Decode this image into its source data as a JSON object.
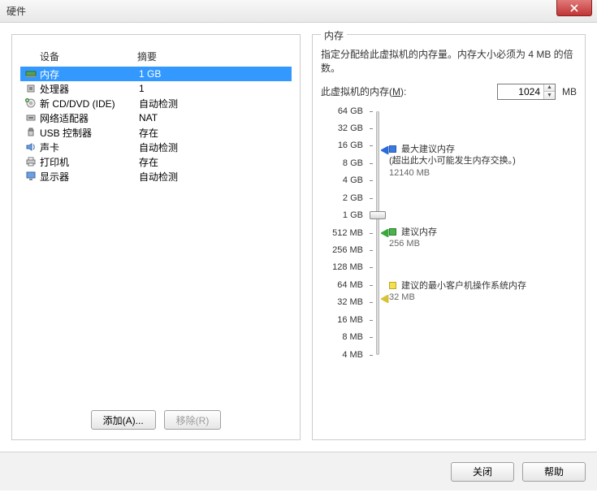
{
  "window_title": "硬件",
  "left": {
    "title": "",
    "headers": {
      "device": "设备",
      "summary": "摘要"
    },
    "devices": [
      {
        "name": "内存",
        "summary": "1 GB",
        "icon": "memory-icon",
        "selected": true
      },
      {
        "name": "处理器",
        "summary": "1",
        "icon": "cpu-icon",
        "selected": false
      },
      {
        "name": "新 CD/DVD (IDE)",
        "summary": "自动检测",
        "icon": "cd-icon",
        "selected": false
      },
      {
        "name": "网络适配器",
        "summary": "NAT",
        "icon": "network-icon",
        "selected": false
      },
      {
        "name": "USB 控制器",
        "summary": "存在",
        "icon": "usb-icon",
        "selected": false
      },
      {
        "name": "声卡",
        "summary": "自动检测",
        "icon": "sound-icon",
        "selected": false
      },
      {
        "name": "打印机",
        "summary": "存在",
        "icon": "printer-icon",
        "selected": false
      },
      {
        "name": "显示器",
        "summary": "自动检测",
        "icon": "display-icon",
        "selected": false
      }
    ],
    "buttons": {
      "add": "添加(A)...",
      "remove": "移除(R)"
    }
  },
  "right": {
    "title": "内存",
    "description": "指定分配给此虚拟机的内存量。内存大小必须为 4 MB 的倍数。",
    "input_label_prefix": "此虚拟机的内存(",
    "input_label_key": "M",
    "input_label_suffix": "):",
    "input_value": "1024",
    "input_unit": "MB",
    "slider": {
      "ticks": [
        {
          "label": "64 GB",
          "pct": 0
        },
        {
          "label": "32 GB",
          "pct": 7.14
        },
        {
          "label": "16 GB",
          "pct": 14.29
        },
        {
          "label": "8 GB",
          "pct": 21.43
        },
        {
          "label": "4 GB",
          "pct": 28.57
        },
        {
          "label": "2 GB",
          "pct": 35.71
        },
        {
          "label": "1 GB",
          "pct": 42.86
        },
        {
          "label": "512 MB",
          "pct": 50
        },
        {
          "label": "256 MB",
          "pct": 57.14
        },
        {
          "label": "128 MB",
          "pct": 64.29
        },
        {
          "label": "64 MB",
          "pct": 71.43
        },
        {
          "label": "32 MB",
          "pct": 78.57
        },
        {
          "label": "16 MB",
          "pct": 85.71
        },
        {
          "label": "8 MB",
          "pct": 92.86
        },
        {
          "label": "4 MB",
          "pct": 100
        }
      ],
      "thumb_pct": 42.86,
      "markers": [
        {
          "kind": "max",
          "pct": 16,
          "color": "#2a6bd8"
        },
        {
          "kind": "rec",
          "pct": 50,
          "color": "#3aa83a"
        },
        {
          "kind": "min",
          "pct": 77,
          "color": "#d8c23a"
        }
      ],
      "legends": {
        "max": {
          "pct": 14,
          "title": "最大建议内存",
          "note": "(超出此大小可能发生内存交换。)",
          "value": "12140 MB"
        },
        "rec": {
          "pct": 48,
          "title": "建议内存",
          "value": "256 MB"
        },
        "min": {
          "pct": 70,
          "title": "建议的最小客户机操作系统内存",
          "value": "32 MB"
        }
      }
    }
  },
  "footer": {
    "close": "关闭",
    "help": "帮助"
  },
  "chart_data": {
    "type": "slider-scale",
    "scale_ticks": [
      "64 GB",
      "32 GB",
      "16 GB",
      "8 GB",
      "4 GB",
      "2 GB",
      "1 GB",
      "512 MB",
      "256 MB",
      "128 MB",
      "64 MB",
      "32 MB",
      "16 MB",
      "8 MB",
      "4 MB"
    ],
    "current_value_mb": 1024,
    "markers": [
      {
        "name": "最大建议内存",
        "value_mb": 12140
      },
      {
        "name": "建议内存",
        "value_mb": 256
      },
      {
        "name": "建议的最小客户机操作系统内存",
        "value_mb": 32
      }
    ]
  }
}
